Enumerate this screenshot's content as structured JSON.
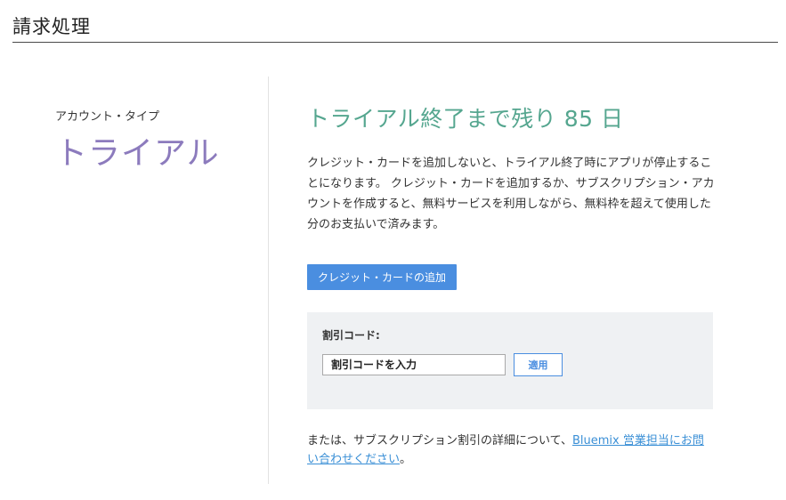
{
  "header": {
    "title": "請求処理"
  },
  "account": {
    "type_label": "アカウント・タイプ",
    "type_value": "トライアル"
  },
  "trial": {
    "heading": "トライアル終了まで残り 85 日",
    "days_remaining": 85,
    "description": "クレジット・カードを追加しないと、トライアル終了時にアプリが停止することになります。 クレジット・カードを追加するか、サブスクリプション・アカウントを作成すると、無料サービスを利用しながら、無料枠を超えて使用した分のお支払いで済みます。"
  },
  "actions": {
    "add_card_label": "クレジット・カードの追加"
  },
  "promo": {
    "label": "割引コード:",
    "placeholder": "割引コードを入力",
    "apply_label": "適用"
  },
  "contact": {
    "prefix": "または、サブスクリプション割引の詳細について、",
    "link_text": "Bluemix 営業担当にお問い合わせください",
    "suffix": "。"
  },
  "colors": {
    "accent_blue": "#4a8ee0",
    "trial_green": "#55a68f",
    "account_purple": "#8c7bbd",
    "link_blue": "#3a8fd6"
  }
}
